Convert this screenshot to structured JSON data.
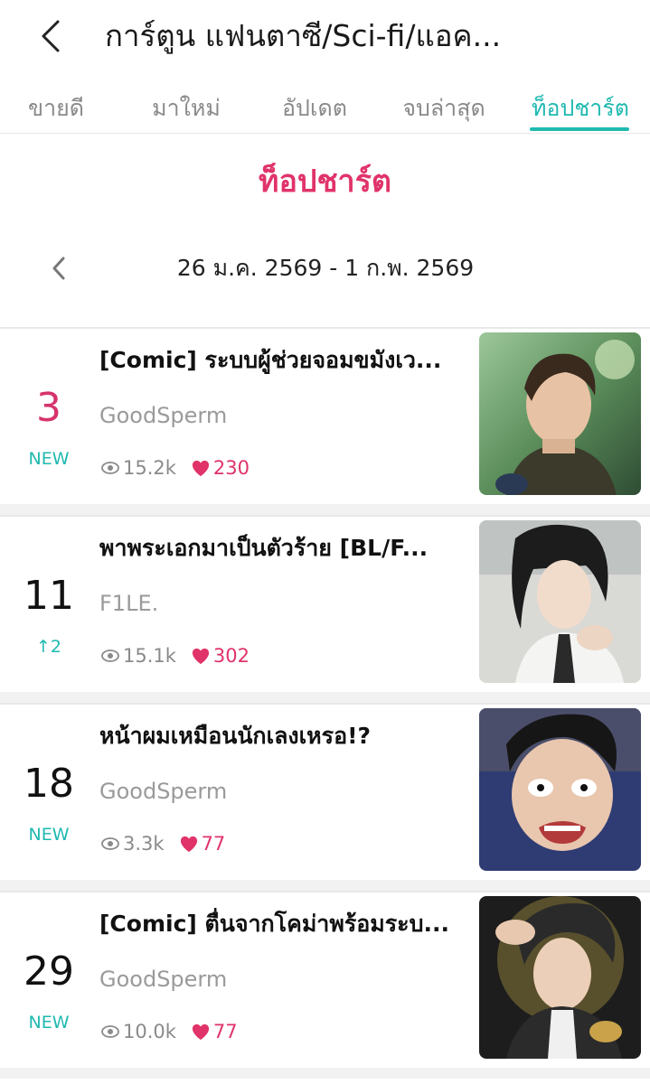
{
  "header": {
    "title": "การ์ตูน แฟนตาซี/Sci-fi/แอค..."
  },
  "tabs": [
    {
      "label": "ขายดี",
      "active": false
    },
    {
      "label": "มาใหม่",
      "active": false
    },
    {
      "label": "อัปเดต",
      "active": false
    },
    {
      "label": "จบล่าสุด",
      "active": false
    },
    {
      "label": "ท็อปชาร์ต",
      "active": true
    }
  ],
  "chart": {
    "heading": "ท็อปชาร์ต",
    "date_range": "26 ม.ค. 2569 - 1 ก.พ. 2569"
  },
  "colors": {
    "accent_teal": "#1fb9b0",
    "accent_pink": "#e0336a",
    "rank_top": "#d6336c",
    "text_dark": "#111111",
    "text_gray": "#9a9a9a"
  },
  "items": [
    {
      "rank": "3",
      "change": "NEW",
      "change_type": "new",
      "title": "[Comic] ระบบผู้ช่วยจอมขมังเว...",
      "author": "GoodSperm",
      "views": "15.2k",
      "likes": "230",
      "thumb_icon": "cover-image"
    },
    {
      "rank": "11",
      "change": "2",
      "change_type": "up",
      "title": "พาพระเอกมาเป็นตัวร้าย [BL/F...",
      "author": "F1LE.",
      "views": "15.1k",
      "likes": "302",
      "thumb_icon": "cover-image"
    },
    {
      "rank": "18",
      "change": "NEW",
      "change_type": "new",
      "title": "หน้าผมเหมือนนักเลงเหรอ!?",
      "author": "GoodSperm",
      "views": "3.3k",
      "likes": "77",
      "thumb_icon": "cover-image"
    },
    {
      "rank": "29",
      "change": "NEW",
      "change_type": "new",
      "title": "[Comic] ตื่นจากโคม่าพร้อมระบ...",
      "author": "GoodSperm",
      "views": "10.0k",
      "likes": "77",
      "thumb_icon": "cover-image"
    }
  ]
}
